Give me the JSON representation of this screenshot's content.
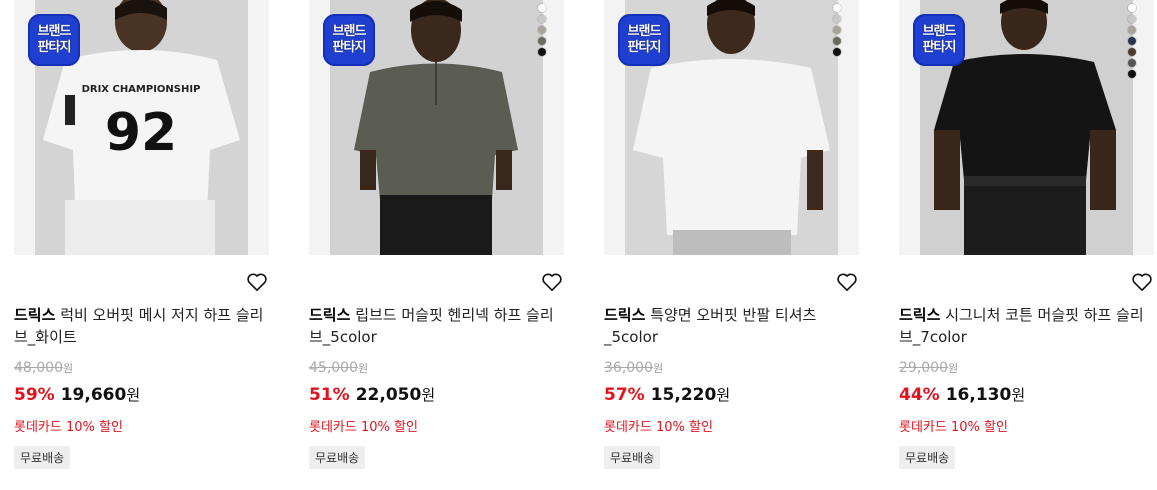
{
  "badge": {
    "line1": "브랜드",
    "line2": "판타지"
  },
  "products": [
    {
      "brand": "드릭스",
      "name": "럭비 오버핏 메시 저지 하프 슬리브_화이트",
      "original_price": "48,000",
      "original_unit": "원",
      "discount": "59%",
      "sale_price": "19,660",
      "sale_unit": "원",
      "card_promo": "롯데카드 10% 할인",
      "shipping": "무료배송",
      "swatches": []
    },
    {
      "brand": "드릭스",
      "name": "립브드 머슬핏 헨리넥 하프 슬리브_5color",
      "original_price": "45,000",
      "original_unit": "원",
      "discount": "51%",
      "sale_price": "22,050",
      "sale_unit": "원",
      "card_promo": "롯데카드 10% 할인",
      "shipping": "무료배송",
      "swatches": [
        "#ffffff",
        "#c9c9c9",
        "#a9a49a",
        "#6a6a60",
        "#111111"
      ]
    },
    {
      "brand": "드릭스",
      "name": "특양면 오버핏 반팔 티셔츠_5color",
      "original_price": "36,000",
      "original_unit": "원",
      "discount": "57%",
      "sale_price": "15,220",
      "sale_unit": "원",
      "card_promo": "롯데카드 10% 할인",
      "shipping": "무료배송",
      "swatches": [
        "#ffffff",
        "#c9c9c9",
        "#a9a49a",
        "#6a6a60",
        "#111111"
      ]
    },
    {
      "brand": "드릭스",
      "name": "시그니처 코튼 머슬핏 하프 슬리브_7color",
      "original_price": "29,000",
      "original_unit": "원",
      "discount": "44%",
      "sale_price": "16,130",
      "sale_unit": "원",
      "card_promo": "롯데카드 10% 할인",
      "shipping": "무료배송",
      "swatches": [
        "#ffffff",
        "#c9c9c9",
        "#a9a49a",
        "#2a3450",
        "#4a3a30",
        "#555555",
        "#111111"
      ]
    }
  ],
  "colors": {
    "accent_red": "#e0141e",
    "badge_blue": "#1f3fd0"
  }
}
